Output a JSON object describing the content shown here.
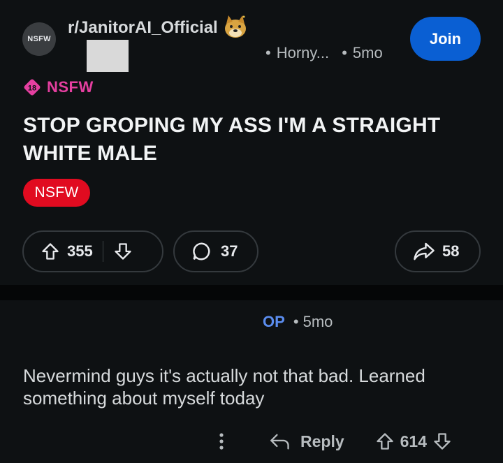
{
  "post": {
    "subreddit_avatar_label": "NSFW",
    "subreddit": "r/JanitorAI_Official",
    "flair_author": "Horny...",
    "age": "5mo",
    "join_label": "Join",
    "nsfw_badge_number": "18",
    "nsfw_label": "NSFW",
    "title": "STOP GROPING MY ASS I'M A STRAIGHT WHITE MALE",
    "nsfw_tag": "NSFW",
    "upvotes": "355",
    "comments": "37",
    "shares": "58"
  },
  "comment": {
    "author": "OP",
    "age": "5mo",
    "body": "Nevermind guys it's actually not that bad. Learned something about myself today",
    "reply_label": "Reply",
    "votes": "614"
  },
  "icons": [
    "doge-icon",
    "upvote-icon",
    "downvote-icon",
    "comment-icon",
    "share-icon",
    "more-icon",
    "reply-icon"
  ],
  "colors": {
    "background": "#0e1113",
    "join": "#0a5fd3",
    "nsfw": "#e10b20",
    "flair": "#e53fa0",
    "op": "#5b8def"
  }
}
